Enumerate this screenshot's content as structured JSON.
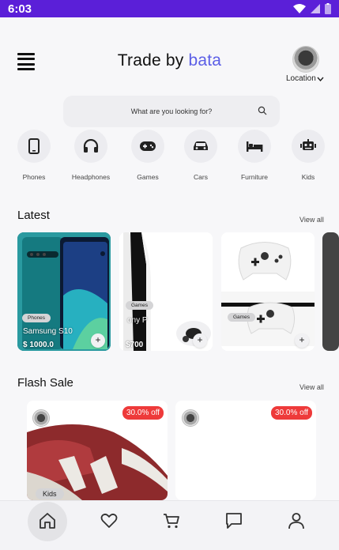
{
  "status": {
    "time": "6:03"
  },
  "header": {
    "title_main": "Trade by ",
    "title_accent": "bata",
    "location_label": "Location"
  },
  "search": {
    "placeholder": "What are you looking for?"
  },
  "categories": [
    {
      "label": "Phones",
      "icon": "phone-icon"
    },
    {
      "label": "Headphones",
      "icon": "headphones-icon"
    },
    {
      "label": "Games",
      "icon": "gamepad-icon"
    },
    {
      "label": "Cars",
      "icon": "car-icon"
    },
    {
      "label": "Furniture",
      "icon": "bed-icon"
    },
    {
      "label": "Kids",
      "icon": "robot-icon"
    }
  ],
  "latest": {
    "title": "Latest",
    "view_all": "View all",
    "items": [
      {
        "tag": "Phones",
        "name": "Samsung S10",
        "price": "$ 1000.0"
      },
      {
        "tag": "Games",
        "name": "ony P",
        "price": "$700"
      },
      {
        "tag": "Games",
        "name": "",
        "price": ""
      }
    ]
  },
  "flash": {
    "title": "Flash Sale",
    "view_all": "View all",
    "items": [
      {
        "discount": "30.0% off",
        "tag": "Kids"
      },
      {
        "discount": "30.0% off"
      }
    ]
  },
  "nav": [
    {
      "name": "home-icon"
    },
    {
      "name": "heart-icon"
    },
    {
      "name": "cart-icon"
    },
    {
      "name": "chat-icon"
    },
    {
      "name": "profile-icon"
    }
  ],
  "colors": {
    "statusbar": "#5b1fd8",
    "accent": "#5b5ee6",
    "discount": "#ee3a3a"
  }
}
